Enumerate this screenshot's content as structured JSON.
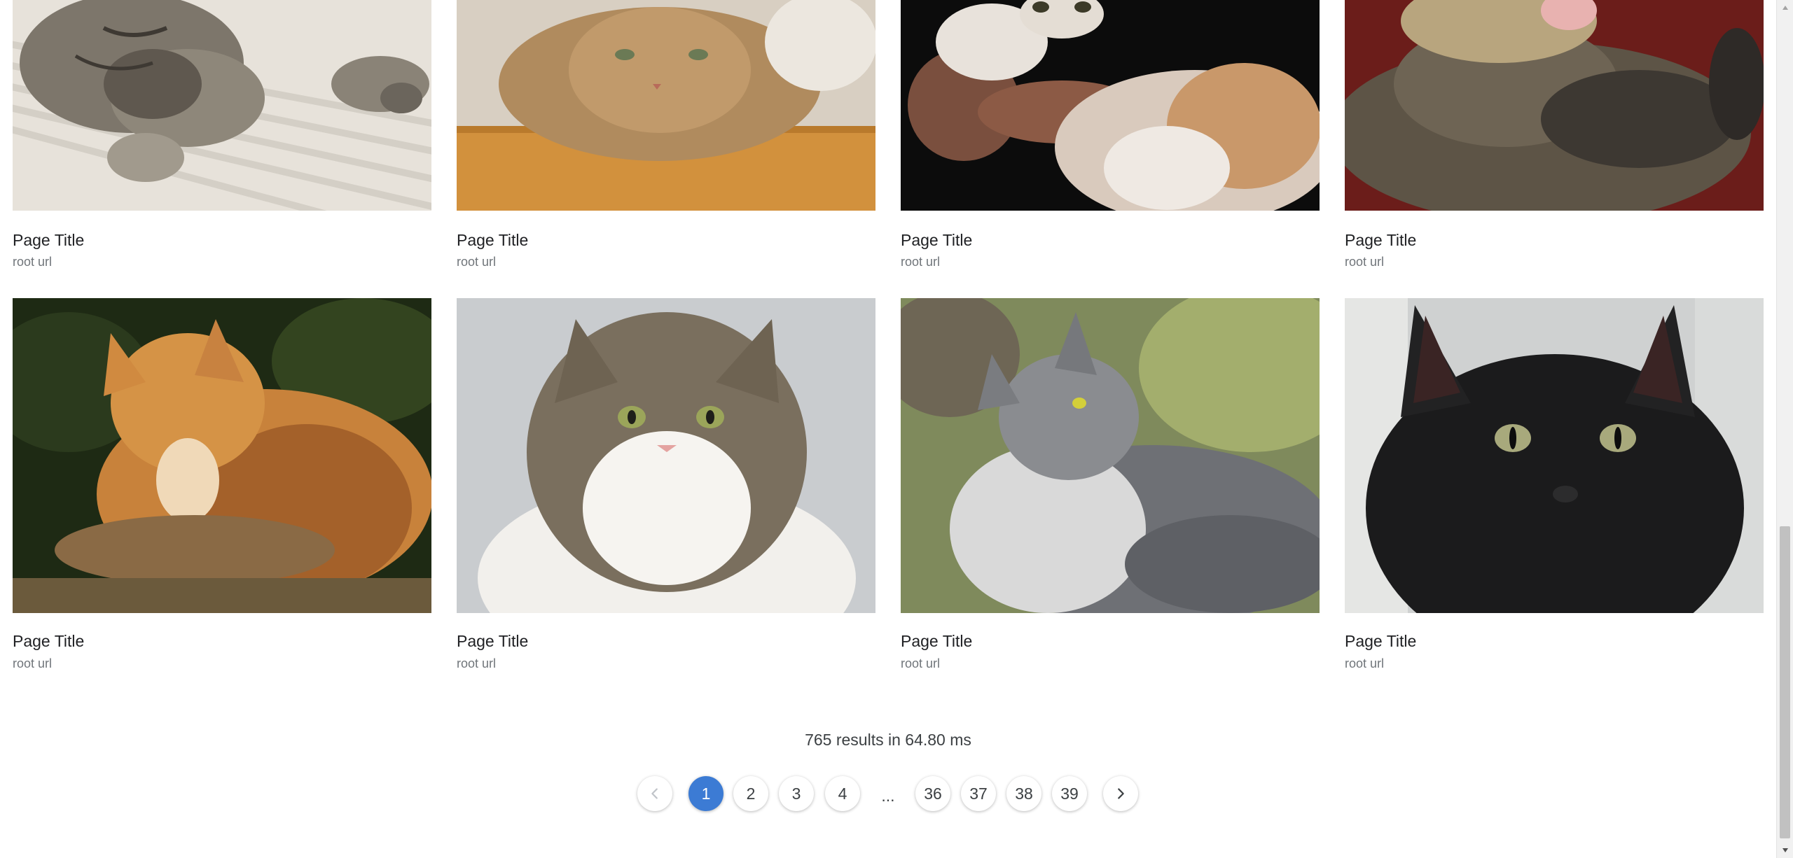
{
  "results": [
    {
      "title": "Page Title",
      "url": "root url",
      "image": "cat-sleeping-tabby"
    },
    {
      "title": "Page Title",
      "url": "root url",
      "image": "cat-fluffy-ginger"
    },
    {
      "title": "Page Title",
      "url": "root url",
      "image": "cat-playing-with-hand"
    },
    {
      "title": "Page Title",
      "url": "root url",
      "image": "cat-yawning"
    },
    {
      "title": "Page Title",
      "url": "root url",
      "image": "cat-orange-grooming"
    },
    {
      "title": "Page Title",
      "url": "root url",
      "image": "cat-norwegian-forest"
    },
    {
      "title": "Page Title",
      "url": "root url",
      "image": "cat-grey-longhair"
    },
    {
      "title": "Page Title",
      "url": "root url",
      "image": "cat-black"
    }
  ],
  "summary": "765 results in 64.80 ms",
  "pagination": {
    "prev_icon": "chevron-left-icon",
    "next_icon": "chevron-right-icon",
    "pages": [
      "1",
      "2",
      "3",
      "4"
    ],
    "ellipsis": "...",
    "last_pages": [
      "36",
      "37",
      "38",
      "39"
    ],
    "current": "1",
    "accent_color": "#3c7bd4"
  }
}
